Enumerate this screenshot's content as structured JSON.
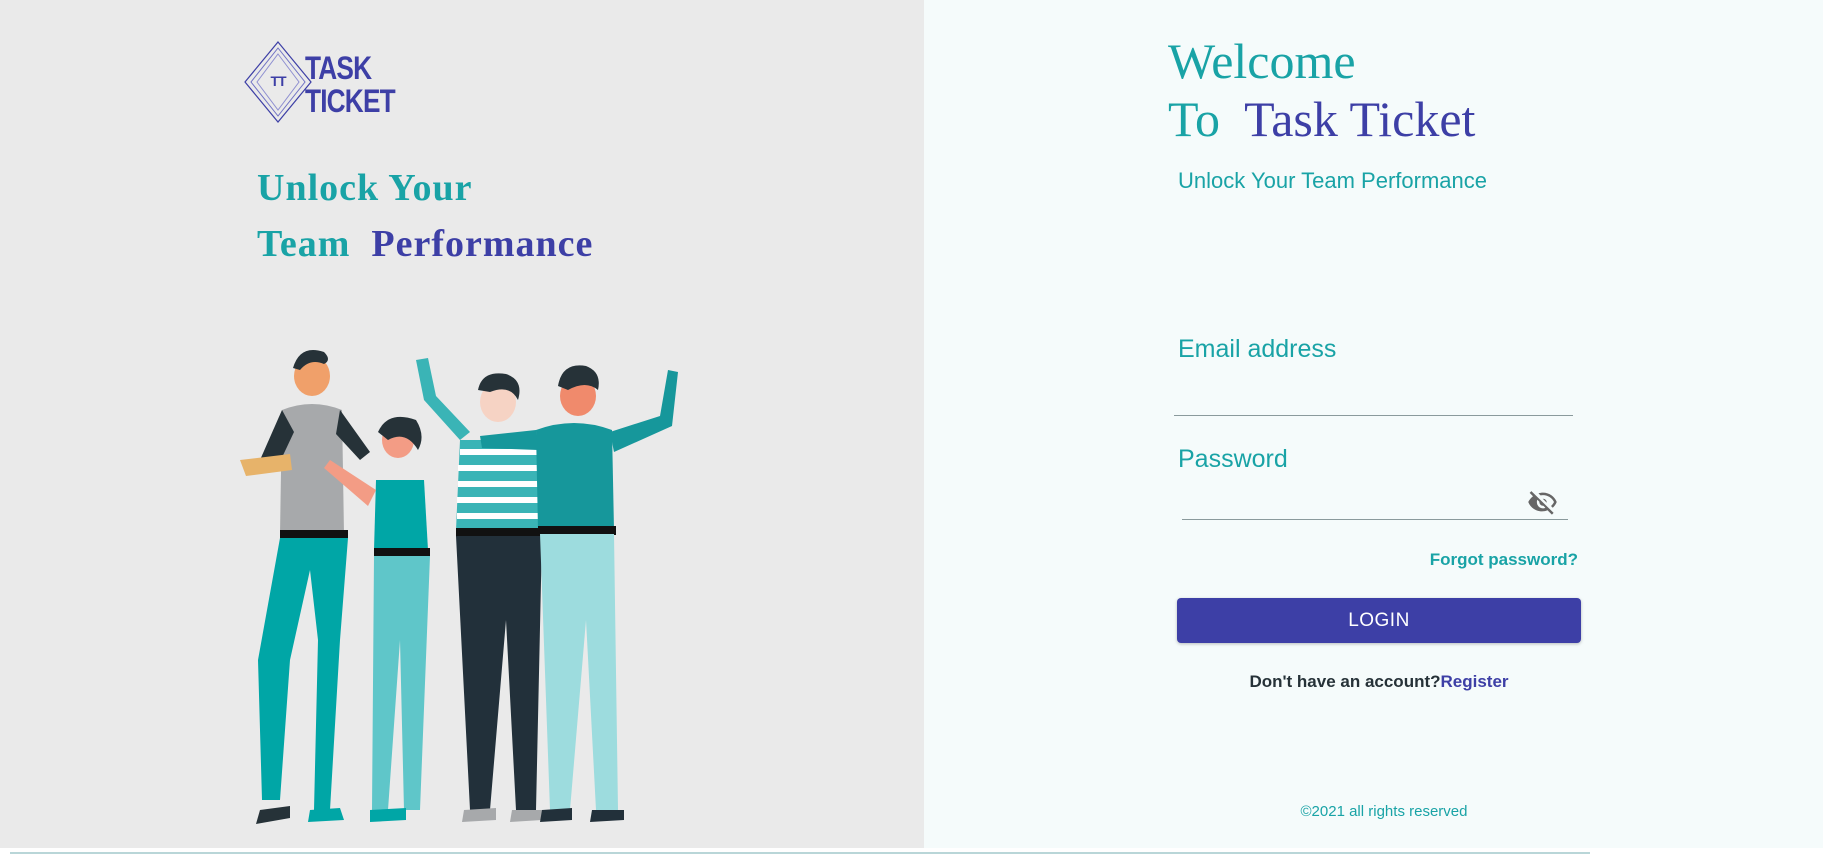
{
  "brand": {
    "logo_initials": "TT",
    "logo_line1": "TASK",
    "logo_line2": "TICKET"
  },
  "left": {
    "tagline_line1": "Unlock Your",
    "tagline_line2_part1": "Team",
    "tagline_line2_part2": "Performance",
    "illustration": "team-of-four-people-illustration"
  },
  "right": {
    "welcome_line1": "Welcome",
    "welcome_line2_part1": "To",
    "welcome_line2_part2": "Task Ticket",
    "subtitle": "Unlock Your Team Performance"
  },
  "form": {
    "email_label": "Email address",
    "email_value": "",
    "password_label": "Password",
    "password_value": "",
    "password_toggle_icon": "eye-off-icon",
    "forgot_password": "Forgot password?",
    "login_button": "LOGIN",
    "no_account_text": "Don't have an account?",
    "register_link": "Register"
  },
  "footer": {
    "copyright": "©2021 all rights reserved"
  },
  "colors": {
    "teal": "#19a3a6",
    "purple": "#3d3fa6",
    "left_bg": "#eaeaea",
    "right_bg": "#f5fbfb"
  }
}
